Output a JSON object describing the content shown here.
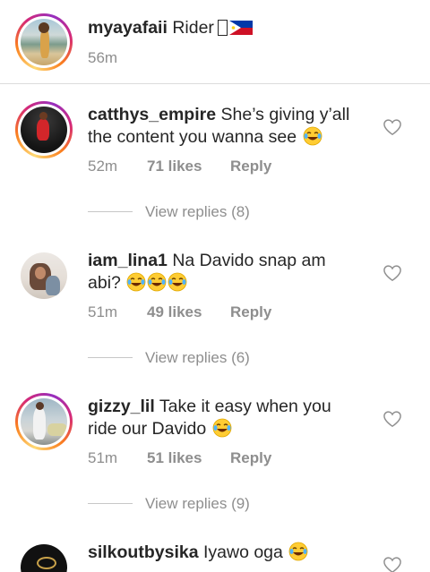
{
  "caption": {
    "username": "myayafaii",
    "text": "Rider",
    "time": "56m",
    "flag_icon": "philippines-flag-icon"
  },
  "comments": [
    {
      "username": "catthys_empire",
      "line1": "She’s giving y’all",
      "line2": "the content you wanna see",
      "emoji": "face-with-tears-of-joy",
      "time": "52m",
      "likes": "71 likes",
      "reply": "Reply",
      "view_replies": "View replies (8)"
    },
    {
      "username": "iam_lina1",
      "line1": "Na Davido snap am",
      "line2": "abi?",
      "emoji": "face-with-tears-of-joy",
      "emoji_count": 3,
      "time": "51m",
      "likes": "49 likes",
      "reply": "Reply",
      "view_replies": "View replies (6)"
    },
    {
      "username": "gizzy_lil",
      "line1": "Take it easy when you",
      "line2": "ride our Davido",
      "emoji": "face-with-tears-of-joy",
      "time": "51m",
      "likes": "51 likes",
      "reply": "Reply",
      "view_replies": "View replies (9)"
    },
    {
      "username": "silkoutbysika",
      "line1": "Iyawo oga",
      "emoji": "face-with-tears-of-joy"
    }
  ],
  "colors": {
    "text": "#262626",
    "meta": "#8e8e8e",
    "divider": "#dbdbdb",
    "heart_stroke": "#8e8e8e"
  }
}
